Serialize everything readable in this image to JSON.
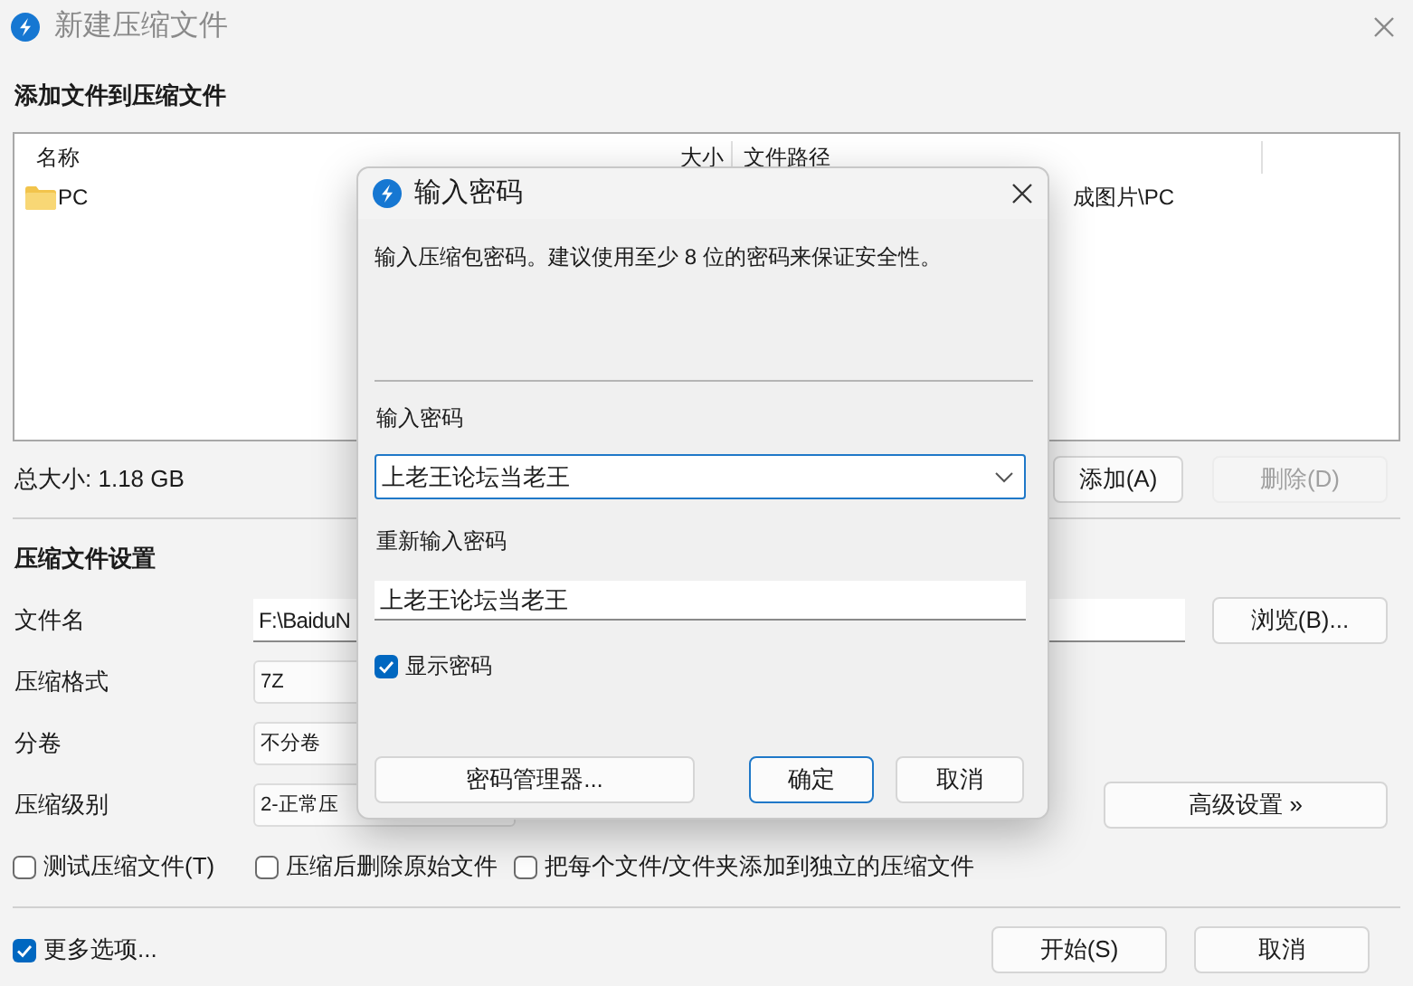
{
  "main_window": {
    "title": "新建压缩文件",
    "add_heading": "添加文件到压缩文件",
    "file_list": {
      "columns": [
        "名称",
        "大小",
        "文件路径"
      ],
      "rows": [
        {
          "name": "PC",
          "path": "成图片\\PC"
        }
      ]
    },
    "total_size": "总大小: 1.18 GB",
    "list_buttons": [
      {
        "label": "添加(A)",
        "disabled": false
      },
      {
        "label": "删除(D)",
        "disabled": true
      }
    ],
    "settings_heading": "压缩文件设置",
    "settings": [
      {
        "label": "文件名",
        "value": "F:\\BaiduN",
        "kind": "text",
        "button": "浏览(B)..."
      },
      {
        "label": "压缩格式",
        "value": "7Z",
        "kind": "dropdown"
      },
      {
        "label": "分卷",
        "value": "不分卷",
        "kind": "dropdown"
      },
      {
        "label": "压缩级别",
        "value": "2-正常压",
        "kind": "dropdown",
        "button": "高级设置 »"
      }
    ],
    "options": [
      {
        "label": "测试压缩文件(T)",
        "checked": false
      },
      {
        "label": "压缩后删除原始文件",
        "checked": false
      },
      {
        "label": "把每个文件/文件夹添加到独立的压缩文件",
        "checked": false
      }
    ],
    "more_options": {
      "label": "更多选项...",
      "checked": true
    },
    "footer_buttons": [
      "开始(S)",
      "取消"
    ]
  },
  "dialog": {
    "title": "输入密码",
    "description": "输入压缩包密码。建议使用至少 8 位的密码来保证安全性。",
    "password": {
      "label": "输入密码",
      "value": "上老王论坛当老王"
    },
    "confirm": {
      "label": "重新输入密码",
      "value": "上老王论坛当老王"
    },
    "show_password": {
      "label": "显示密码",
      "checked": true
    },
    "buttons": [
      {
        "label": "密码管理器...",
        "kind": "manager"
      },
      {
        "label": "确定",
        "kind": "default"
      },
      {
        "label": "取消",
        "kind": "normal"
      }
    ]
  }
}
